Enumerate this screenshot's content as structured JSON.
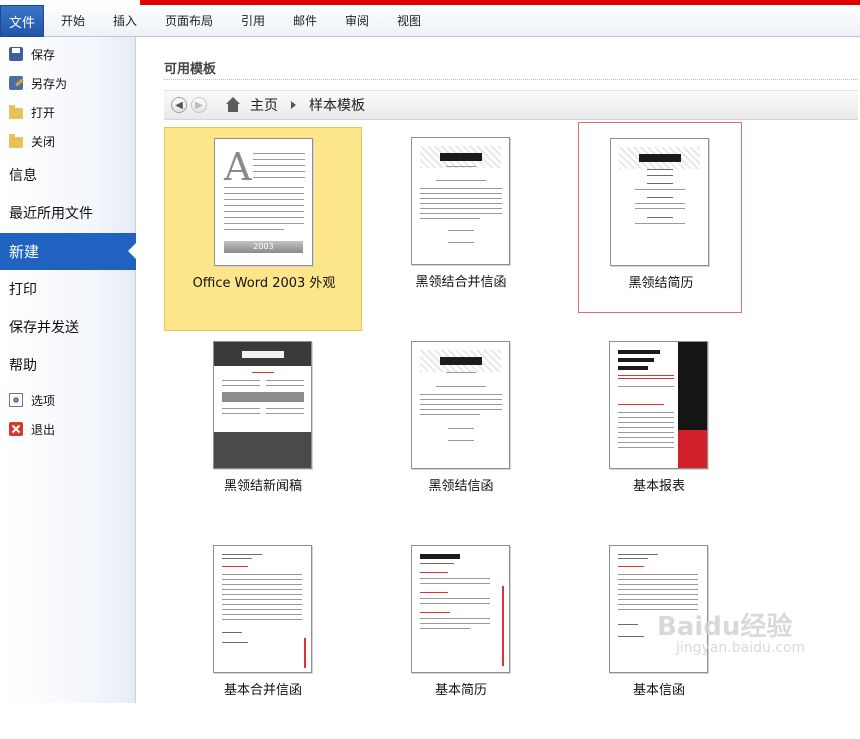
{
  "ribbon": {
    "file_tab": "文件",
    "tabs": [
      "开始",
      "插入",
      "页面布局",
      "引用",
      "邮件",
      "审阅",
      "视图"
    ]
  },
  "sidebar": {
    "quick_commands": [
      {
        "label": "保存",
        "icon": "save-icon"
      },
      {
        "label": "另存为",
        "icon": "save-as-icon"
      },
      {
        "label": "打开",
        "icon": "open-folder-icon"
      },
      {
        "label": "关闭",
        "icon": "close-folder-icon"
      }
    ],
    "nav": {
      "info": "信息",
      "recent": "最近所用文件",
      "new": "新建",
      "print": "打印",
      "save_send": "保存并发送",
      "help": "帮助"
    },
    "bottom_commands": [
      {
        "label": "选项",
        "icon": "options-icon"
      },
      {
        "label": "退出",
        "icon": "exit-icon"
      }
    ]
  },
  "main": {
    "section_title": "可用模板",
    "breadcrumb": {
      "home": "主页",
      "current": "样本模板"
    },
    "templates": [
      {
        "label": "Office Word 2003 外观",
        "state": "selected",
        "year": "2003"
      },
      {
        "label": "黑领结合并信函",
        "state": "normal"
      },
      {
        "label": "黑领结简历",
        "state": "hovered"
      },
      {
        "label": "黑领结新闻稿",
        "state": "normal"
      },
      {
        "label": "黑领结信函",
        "state": "normal"
      },
      {
        "label": "基本报表",
        "state": "normal"
      },
      {
        "label": "基本合并信函",
        "state": "normal"
      },
      {
        "label": "基本简历",
        "state": "normal"
      },
      {
        "label": "基本信函",
        "state": "normal"
      }
    ]
  },
  "watermark": {
    "brand": "Baidu经验",
    "url": "jingyan.baidu.com"
  },
  "colors": {
    "accent_blue": "#1f62bf",
    "selected_tile": "#fde68a",
    "hover_border": "#e36b6b",
    "title_bar_red": "#e00000"
  }
}
